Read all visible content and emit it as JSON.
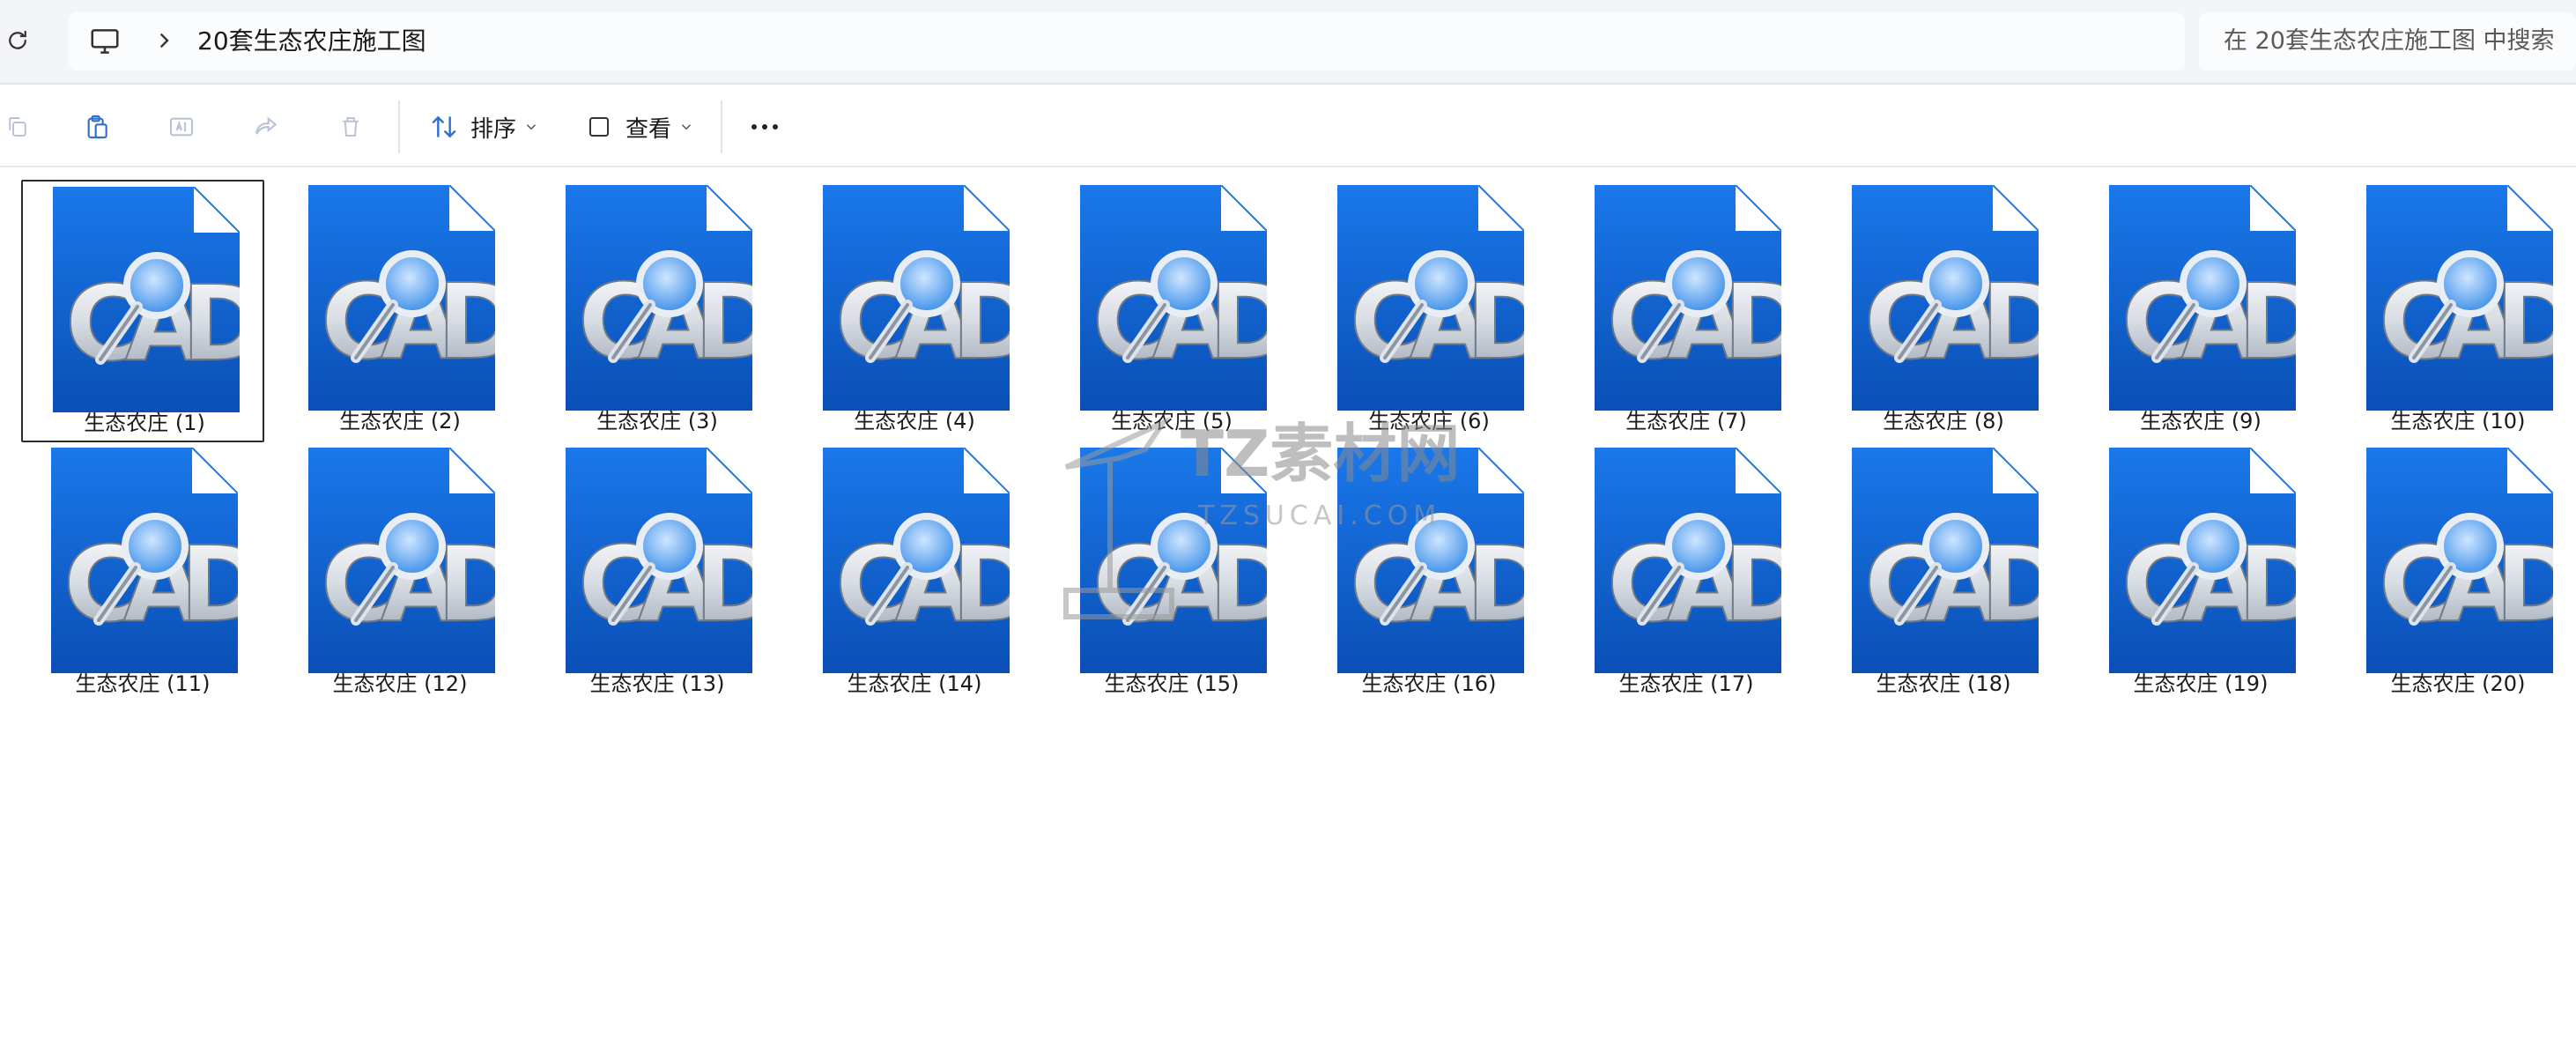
{
  "window": {
    "breadcrumb": "20套生态农庄施工图",
    "search_placeholder": "在 20套生态农庄施工图 中搜索"
  },
  "toolbar": {
    "sort_label": "排序",
    "view_label": "查看"
  },
  "files": [
    {
      "label": "生态农庄 (1)"
    },
    {
      "label": "生态农庄 (2)"
    },
    {
      "label": "生态农庄 (3)"
    },
    {
      "label": "生态农庄 (4)"
    },
    {
      "label": "生态农庄 (5)"
    },
    {
      "label": "生态农庄 (6)"
    },
    {
      "label": "生态农庄 (7)"
    },
    {
      "label": "生态农庄 (8)"
    },
    {
      "label": "生态农庄 (9)"
    },
    {
      "label": "生态农庄 (10)"
    },
    {
      "label": "生态农庄 (11)"
    },
    {
      "label": "生态农庄 (12)"
    },
    {
      "label": "生态农庄 (13)"
    },
    {
      "label": "生态农庄 (14)"
    },
    {
      "label": "生态农庄 (15)"
    },
    {
      "label": "生态农庄 (16)"
    },
    {
      "label": "生态农庄 (17)"
    },
    {
      "label": "生态农庄 (18)"
    },
    {
      "label": "生态农庄 (19)"
    },
    {
      "label": "生态农庄 (20)"
    }
  ],
  "file_icon": "cad-file-icon",
  "watermark": {
    "title": "TZ素材网",
    "domain": "TZSUCAI.COM"
  },
  "colors": {
    "cad_blue_top": "#1a73e8",
    "cad_blue_bottom": "#0a4fb5",
    "selection_border": "#2b2b2b"
  }
}
